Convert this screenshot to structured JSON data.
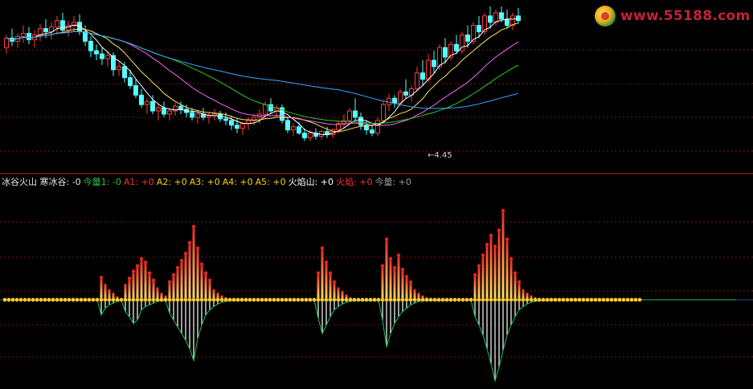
{
  "watermark": {
    "text": "www.55188.com",
    "logo_icon": "yinyang-logo-icon"
  },
  "legend": [
    {
      "text": "冰谷火山 寒冰谷: -0",
      "color": "#e6e6e6"
    },
    {
      "text": "今量1: -0",
      "color": "#2fbf4a"
    },
    {
      "text": "A1: +0",
      "color": "#ff3030"
    },
    {
      "text": "A2: +0",
      "color": "#ffd700"
    },
    {
      "text": "A3: +0",
      "color": "#ffd700"
    },
    {
      "text": "A4: +0",
      "color": "#ffd700"
    },
    {
      "text": "A5: +0",
      "color": "#ffd700"
    },
    {
      "text": "火焰山: +0",
      "color": "#ffffff"
    },
    {
      "text": "火焰: +0",
      "color": "#ff3030"
    },
    {
      "text": "今量: +0",
      "color": "#9a9a9a"
    }
  ],
  "chart_data": [
    {
      "type": "candlestick",
      "min_price_label": "4.45",
      "colors": {
        "up": "#ff3c3c",
        "down": "#54ffff",
        "ma5": "#ffffff",
        "ma10": "#ffe45a",
        "ma20": "#ff66ff",
        "ma30": "#22d022",
        "ma60": "#3aa8ff"
      },
      "ylim": [
        4.3,
        5.3
      ],
      "candles": [
        [
          5.04,
          5.12,
          5.0,
          5.1
        ],
        [
          5.1,
          5.16,
          5.05,
          5.08
        ],
        [
          5.08,
          5.13,
          5.04,
          5.11
        ],
        [
          5.11,
          5.18,
          5.07,
          5.13
        ],
        [
          5.13,
          5.17,
          5.06,
          5.09
        ],
        [
          5.09,
          5.15,
          5.04,
          5.12
        ],
        [
          5.12,
          5.19,
          5.08,
          5.16
        ],
        [
          5.16,
          5.22,
          5.1,
          5.14
        ],
        [
          5.14,
          5.2,
          5.09,
          5.17
        ],
        [
          5.17,
          5.24,
          5.12,
          5.21
        ],
        [
          5.21,
          5.26,
          5.13,
          5.15
        ],
        [
          5.15,
          5.21,
          5.11,
          5.18
        ],
        [
          5.18,
          5.24,
          5.14,
          5.2
        ],
        [
          5.2,
          5.25,
          5.12,
          5.14
        ],
        [
          5.14,
          5.18,
          5.05,
          5.08
        ],
        [
          5.08,
          5.11,
          4.98,
          5.02
        ],
        [
          5.02,
          5.06,
          4.96,
          5.0
        ],
        [
          5.0,
          5.04,
          4.93,
          4.97
        ],
        [
          4.97,
          5.02,
          4.92,
          4.99
        ],
        [
          4.99,
          5.01,
          4.86,
          4.9
        ],
        [
          4.9,
          4.95,
          4.86,
          4.92
        ],
        [
          4.92,
          4.95,
          4.82,
          4.85
        ],
        [
          4.85,
          4.9,
          4.78,
          4.8
        ],
        [
          4.8,
          4.84,
          4.72,
          4.74
        ],
        [
          4.74,
          4.78,
          4.66,
          4.68
        ],
        [
          4.68,
          4.72,
          4.62,
          4.7
        ],
        [
          4.7,
          4.74,
          4.62,
          4.64
        ],
        [
          4.64,
          4.68,
          4.58,
          4.66
        ],
        [
          4.66,
          4.7,
          4.6,
          4.62
        ],
        [
          4.62,
          4.66,
          4.58,
          4.64
        ],
        [
          4.64,
          4.69,
          4.61,
          4.67
        ],
        [
          4.67,
          4.7,
          4.62,
          4.65
        ],
        [
          4.65,
          4.68,
          4.6,
          4.63
        ],
        [
          4.63,
          4.66,
          4.58,
          4.6
        ],
        [
          4.6,
          4.64,
          4.56,
          4.62
        ],
        [
          4.62,
          4.66,
          4.58,
          4.6
        ],
        [
          4.6,
          4.63,
          4.56,
          4.61
        ],
        [
          4.61,
          4.65,
          4.58,
          4.62
        ],
        [
          4.62,
          4.64,
          4.57,
          4.59
        ],
        [
          4.59,
          4.63,
          4.55,
          4.58
        ],
        [
          4.58,
          4.61,
          4.52,
          4.55
        ],
        [
          4.55,
          4.59,
          4.5,
          4.53
        ],
        [
          4.53,
          4.57,
          4.49,
          4.56
        ],
        [
          4.56,
          4.6,
          4.52,
          4.58
        ],
        [
          4.58,
          4.62,
          4.55,
          4.6
        ],
        [
          4.6,
          4.65,
          4.56,
          4.62
        ],
        [
          4.62,
          4.7,
          4.59,
          4.68
        ],
        [
          4.68,
          4.72,
          4.62,
          4.64
        ],
        [
          4.64,
          4.68,
          4.6,
          4.66
        ],
        [
          4.66,
          4.68,
          4.56,
          4.58
        ],
        [
          4.58,
          4.6,
          4.5,
          4.52
        ],
        [
          4.52,
          4.56,
          4.48,
          4.54
        ],
        [
          4.54,
          4.57,
          4.49,
          4.5
        ],
        [
          4.5,
          4.53,
          4.45,
          4.47
        ],
        [
          4.47,
          4.52,
          4.45,
          4.5
        ],
        [
          4.5,
          4.53,
          4.46,
          4.48
        ],
        [
          4.48,
          4.52,
          4.46,
          4.51
        ],
        [
          4.51,
          4.54,
          4.47,
          4.49
        ],
        [
          4.49,
          4.53,
          4.47,
          4.52
        ],
        [
          4.52,
          4.58,
          4.5,
          4.56
        ],
        [
          4.56,
          4.62,
          4.53,
          4.58
        ],
        [
          4.58,
          4.66,
          4.55,
          4.64
        ],
        [
          4.64,
          4.72,
          4.58,
          4.6
        ],
        [
          4.6,
          4.63,
          4.52,
          4.55
        ],
        [
          4.55,
          4.58,
          4.49,
          4.52
        ],
        [
          4.52,
          4.55,
          4.48,
          4.5
        ],
        [
          4.5,
          4.6,
          4.48,
          4.58
        ],
        [
          4.58,
          4.7,
          4.56,
          4.68
        ],
        [
          4.68,
          4.75,
          4.64,
          4.72
        ],
        [
          4.72,
          4.74,
          4.66,
          4.69
        ],
        [
          4.69,
          4.78,
          4.67,
          4.76
        ],
        [
          4.76,
          4.84,
          4.72,
          4.74
        ],
        [
          4.74,
          4.8,
          4.7,
          4.78
        ],
        [
          4.78,
          4.92,
          4.76,
          4.88
        ],
        [
          4.88,
          4.96,
          4.8,
          4.84
        ],
        [
          4.84,
          5.0,
          4.82,
          4.96
        ],
        [
          4.96,
          5.02,
          4.88,
          4.92
        ],
        [
          4.92,
          5.06,
          4.9,
          5.04
        ],
        [
          5.04,
          5.1,
          4.94,
          4.98
        ],
        [
          4.98,
          5.08,
          4.96,
          5.06
        ],
        [
          5.06,
          5.12,
          5.0,
          5.02
        ],
        [
          5.02,
          5.14,
          5.0,
          5.12
        ],
        [
          5.12,
          5.18,
          5.04,
          5.08
        ],
        [
          5.08,
          5.2,
          5.06,
          5.18
        ],
        [
          5.18,
          5.24,
          5.1,
          5.14
        ],
        [
          5.14,
          5.26,
          5.12,
          5.24
        ],
        [
          5.24,
          5.3,
          5.16,
          5.2
        ],
        [
          5.2,
          5.28,
          5.18,
          5.26
        ],
        [
          5.26,
          5.3,
          5.2,
          5.22
        ],
        [
          5.22,
          5.28,
          5.16,
          5.18
        ],
        [
          5.18,
          5.26,
          5.15,
          5.24
        ],
        [
          5.24,
          5.29,
          5.19,
          5.21
        ]
      ]
    },
    {
      "type": "bar",
      "description_series": [
        "火焰山",
        "寒冰谷"
      ],
      "colors": {
        "positive_bottom": "#ffe26a",
        "positive_top": "#e8241e",
        "negative": "#ffffff",
        "negative_outline": "#18c25a",
        "marker": "#ffd43a"
      },
      "ylim": [
        -1.0,
        1.0
      ],
      "baseline_markers_count": 159,
      "values_positive": [
        0,
        0,
        0,
        0,
        0,
        0,
        0,
        0,
        0,
        0,
        0,
        0,
        0,
        0,
        0,
        0,
        0,
        0,
        0,
        0,
        0,
        0,
        0,
        0,
        0.25,
        0.18,
        0.12,
        0.08,
        0.04,
        0.02,
        0.18,
        0.24,
        0.32,
        0.38,
        0.46,
        0.42,
        0.3,
        0.22,
        0.14,
        0.08,
        0.05,
        0.2,
        0.28,
        0.36,
        0.44,
        0.52,
        0.64,
        0.82,
        0.58,
        0.4,
        0.3,
        0.22,
        0.12,
        0.08,
        0.05,
        0.03,
        0.02,
        0.01,
        0.01,
        0.01,
        0,
        0,
        0,
        0,
        0,
        0,
        0,
        0,
        0,
        0,
        0,
        0,
        0,
        0,
        0,
        0,
        0,
        0,
        0.3,
        0.58,
        0.42,
        0.3,
        0.2,
        0.14,
        0.1,
        0.06,
        0.03,
        0.02,
        0.01,
        0.01,
        0.01,
        0.01,
        0.01,
        0.01,
        0.38,
        0.68,
        0.46,
        0.36,
        0.5,
        0.34,
        0.26,
        0.2,
        0.12,
        0.08,
        0.05,
        0.03,
        0.02,
        0.01,
        0.01,
        0.01,
        0.01,
        0.01,
        0,
        0,
        0,
        0,
        0,
        0.28,
        0.38,
        0.5,
        0.62,
        0.72,
        0.6,
        0.78,
        1.0,
        0.68,
        0.46,
        0.3,
        0.2,
        0.12,
        0.08,
        0.05,
        0.03,
        0.02,
        0.01,
        0.01,
        0.01,
        0,
        0,
        0,
        0,
        0,
        0,
        0,
        0,
        0,
        0,
        0,
        0,
        0,
        0,
        0,
        0,
        0,
        0,
        0,
        0,
        0,
        0,
        0,
        0,
        0,
        0,
        0,
        0,
        0,
        0,
        0,
        0,
        0,
        0,
        0,
        0,
        0,
        0,
        0,
        0,
        0,
        0,
        0,
        0,
        0,
        0
      ],
      "values_negative": [
        0,
        0,
        0,
        0,
        0,
        0,
        0,
        0,
        0,
        0,
        0,
        0,
        0,
        0,
        0,
        0,
        0,
        0,
        0,
        0,
        0,
        0,
        0,
        0,
        -0.18,
        -0.1,
        -0.06,
        -0.04,
        -0.02,
        -0.01,
        -0.14,
        -0.2,
        -0.28,
        -0.24,
        -0.12,
        -0.08,
        -0.06,
        -0.04,
        -0.02,
        -0.01,
        -0.01,
        -0.16,
        -0.24,
        -0.32,
        -0.4,
        -0.48,
        -0.58,
        -0.72,
        -0.46,
        -0.3,
        -0.18,
        -0.12,
        -0.08,
        -0.05,
        -0.03,
        -0.02,
        -0.01,
        -0.01,
        -0.01,
        -0.01,
        0,
        0,
        0,
        0,
        0,
        0,
        0,
        0,
        0,
        0,
        0,
        0,
        0,
        0,
        0,
        0,
        0,
        0,
        -0.22,
        -0.4,
        -0.3,
        -0.2,
        -0.12,
        -0.08,
        -0.05,
        -0.03,
        -0.02,
        -0.01,
        -0.01,
        -0.01,
        -0.01,
        -0.01,
        -0.01,
        -0.01,
        -0.24,
        -0.56,
        -0.4,
        -0.28,
        -0.2,
        -0.14,
        -0.1,
        -0.06,
        -0.04,
        -0.02,
        -0.01,
        -0.01,
        -0.01,
        -0.01,
        -0.01,
        -0.01,
        -0.01,
        -0.01,
        0,
        0,
        0,
        0,
        0,
        -0.2,
        -0.3,
        -0.42,
        -0.58,
        -0.76,
        -0.96,
        -0.8,
        -0.6,
        -0.42,
        -0.3,
        -0.2,
        -0.12,
        -0.08,
        -0.05,
        -0.03,
        -0.02,
        -0.01,
        -0.01,
        -0.01,
        -0.01,
        0,
        0,
        0,
        0,
        0,
        0,
        0,
        0,
        0,
        0,
        0,
        0,
        0,
        0,
        0,
        0,
        0,
        0,
        0,
        0,
        0,
        0,
        0,
        0,
        0,
        0,
        0,
        0,
        0,
        0,
        0,
        0,
        0,
        0,
        0,
        0,
        0,
        0,
        0,
        0,
        0,
        0,
        0,
        0,
        0,
        0
      ]
    }
  ]
}
